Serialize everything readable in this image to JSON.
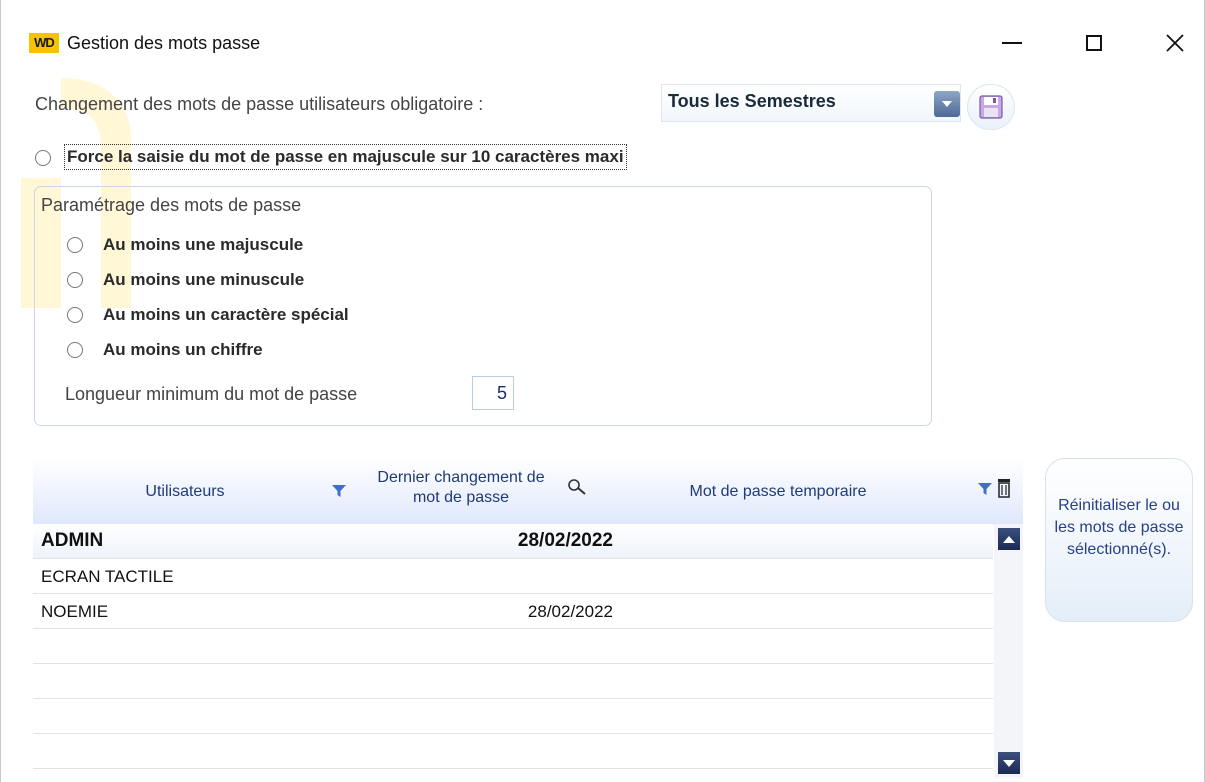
{
  "window": {
    "logo_text": "WD",
    "title": "Gestion des mots passe"
  },
  "password_change": {
    "label": "Changement des mots de passe utilisateurs obligatoire :",
    "selected": "Tous les Semestres"
  },
  "force_uppercase": {
    "label": "Force la saisie du mot de passe en majuscule sur 10 caractères maxi"
  },
  "settings_group": {
    "title": "Paramétrage des mots de passe",
    "options": [
      "Au moins une majuscule",
      "Au moins une minuscule",
      "Au moins un caractère spécial",
      "Au moins un chiffre"
    ],
    "min_length_label": "Longueur minimum du mot de passe",
    "min_length_value": "5"
  },
  "table": {
    "columns": [
      "Utilisateurs",
      "Dernier changement de mot de passe",
      "Mot de passe temporaire"
    ],
    "col2_line1": "Dernier changement de",
    "col2_line2": "mot de passe",
    "rows": [
      {
        "user": "ADMIN",
        "date": "28/02/2022"
      },
      {
        "user": "ECRAN TACTILE",
        "date": ""
      },
      {
        "user": "NOEMIE",
        "date": "28/02/2022"
      }
    ]
  },
  "reset_button": {
    "label": "Réinitialiser le ou les mots de passe sélectionné(s)."
  },
  "colors": {
    "accent_yellow": "#f5c400",
    "header_text": "#1f3a7a",
    "scroll_button": "#1a2b55"
  },
  "icons": [
    "wd-logo-icon",
    "minimize-icon",
    "maximize-icon",
    "close-icon",
    "save-icon",
    "filter-icon",
    "search-icon",
    "delete-column-icon",
    "scroll-up-icon",
    "scroll-down-icon"
  ]
}
